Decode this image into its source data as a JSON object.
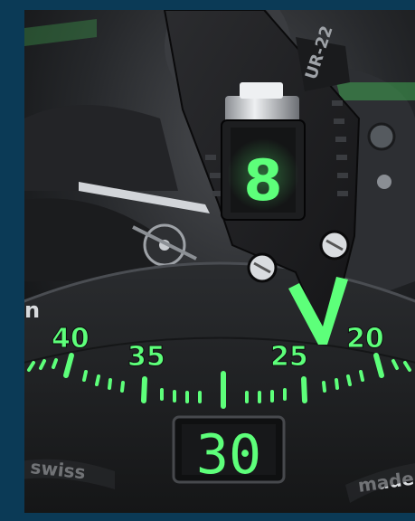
{
  "image": {
    "subject": "close-up of watch dial",
    "colors": {
      "frame": "#0b3a56",
      "lume_green": "#5dff7a",
      "metal_dark": "#1b1c1e",
      "metal_mid": "#3a3c40",
      "metal_light": "#c9ccd0"
    }
  },
  "dial": {
    "minute_labels": [
      "40",
      "35",
      "25",
      "20"
    ],
    "date_window": "30",
    "hour_digit": "8",
    "model_engraving": "UR-22",
    "left_edge_text": "n",
    "bottom_left_text": "swiss",
    "bottom_right_text": "made"
  }
}
